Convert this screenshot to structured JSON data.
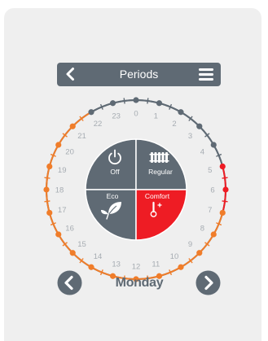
{
  "header": {
    "title": "Periods",
    "back_icon": "chevron-left-icon",
    "menu_icon": "hamburger-menu-icon"
  },
  "dial": {
    "hours": [
      "0",
      "1",
      "2",
      "3",
      "4",
      "5",
      "6",
      "7",
      "8",
      "9",
      "10",
      "11",
      "12",
      "13",
      "14",
      "15",
      "16",
      "17",
      "18",
      "19",
      "20",
      "21",
      "22",
      "23"
    ],
    "hour_period_colors": [
      "grey",
      "grey",
      "grey",
      "grey",
      "grey",
      "red",
      "red",
      "orange",
      "orange",
      "orange",
      "orange",
      "orange",
      "orange",
      "orange",
      "orange",
      "orange",
      "orange",
      "orange",
      "orange",
      "orange",
      "orange",
      "orange",
      "grey",
      "grey"
    ],
    "quadrants": {
      "off": {
        "label": "Off",
        "icon": "power-icon",
        "color": "#5f6a74"
      },
      "regular": {
        "label": "Regular",
        "icon": "radiator-icon",
        "color": "#5f6a74"
      },
      "eco": {
        "label": "Eco",
        "icon": "leaf-icon",
        "color": "#5f6a74"
      },
      "comfort": {
        "label": "Comfort",
        "icon": "thermometer-up-icon",
        "color": "#ee1c24"
      }
    }
  },
  "colors": {
    "grey": "#5f6a74",
    "orange": "#f07d2a",
    "red": "#ee1c24",
    "tick": "#a6acb2"
  },
  "day": {
    "label": "Monday",
    "prev_icon": "chevron-left-circle-icon",
    "next_icon": "chevron-right-circle-icon"
  }
}
